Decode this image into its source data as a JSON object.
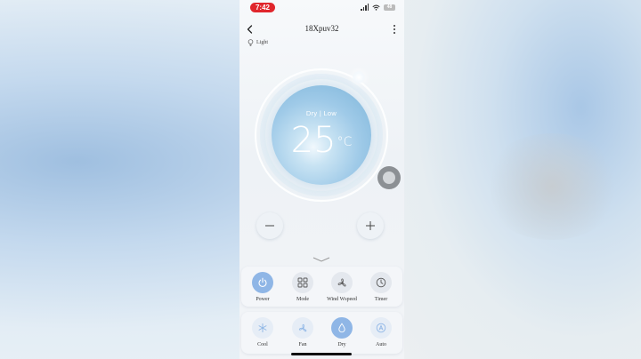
{
  "status_bar": {
    "time": "7:42",
    "battery": "48"
  },
  "header": {
    "title": "18Xpuv32"
  },
  "light": {
    "label": "Light"
  },
  "dial": {
    "mode_text": "Dry | Low",
    "temperature": "25",
    "unit": "°C"
  },
  "row1": [
    {
      "label": "Power",
      "icon": "power-icon",
      "active": true
    },
    {
      "label": "Mode",
      "icon": "grid-icon",
      "active": false
    },
    {
      "label": "Wind Wspeed",
      "icon": "fan-speed-icon",
      "active": false
    },
    {
      "label": "Timer",
      "icon": "clock-icon",
      "active": false
    }
  ],
  "row2": [
    {
      "label": "Cool",
      "icon": "snowflake-icon",
      "active": false
    },
    {
      "label": "Fan",
      "icon": "fan-icon",
      "active": false
    },
    {
      "label": "Dry",
      "icon": "droplet-icon",
      "active": true
    },
    {
      "label": "Auto",
      "icon": "auto-icon",
      "active": false
    }
  ],
  "colors": {
    "accent": "#8fb6e6",
    "status_pill": "#e0262c"
  }
}
